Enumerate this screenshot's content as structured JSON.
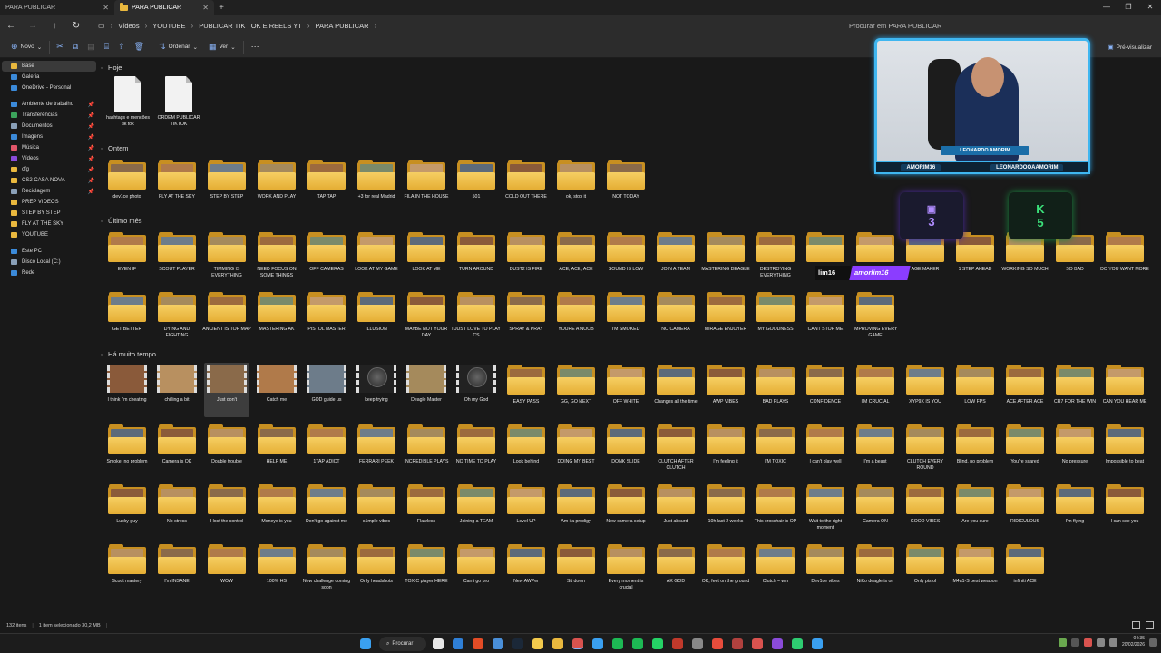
{
  "tabs": [
    {
      "label": "PARA PUBLICAR",
      "active": false
    },
    {
      "label": "PARA PUBLICAR",
      "active": true
    }
  ],
  "breadcrumbs": [
    "Vídeos",
    "YOUTUBE",
    "PUBLICAR TIK TOK E REELS YT",
    "PARA PUBLICAR"
  ],
  "search_placeholder": "Procurar em PARA PUBLICAR",
  "toolbar": {
    "new_label": "Novo",
    "sort_label": "Ordenar",
    "view_label": "Ver",
    "preview_label": "Pré-visualizar"
  },
  "sidebar": {
    "quick": [
      {
        "label": "Base",
        "color": "#e9b83e",
        "sel": true
      },
      {
        "label": "Galeria",
        "color": "#3b8ad9"
      },
      {
        "label": "OneDrive - Personal",
        "color": "#3b8ad9"
      }
    ],
    "pinned": [
      {
        "label": "Ambiente de trabalho",
        "color": "#3b8ad9",
        "pin": true
      },
      {
        "label": "Transferências",
        "color": "#3ca45c",
        "pin": true
      },
      {
        "label": "Documentos",
        "color": "#8aa0b8",
        "pin": true
      },
      {
        "label": "Imagens",
        "color": "#3b8ad9",
        "pin": true
      },
      {
        "label": "Música",
        "color": "#e2566a",
        "pin": true
      },
      {
        "label": "Vídeos",
        "color": "#8a4bd9",
        "pin": true
      },
      {
        "label": "cfg",
        "color": "#e9b83e",
        "pin": true
      },
      {
        "label": "CS2 CASA NOVA",
        "color": "#e9b83e",
        "pin": true
      },
      {
        "label": "Reciclagem",
        "color": "#8aa0b8",
        "pin": true
      },
      {
        "label": "PREP VIDEOS",
        "color": "#e9b83e"
      },
      {
        "label": "STEP BY STEP",
        "color": "#e9b83e"
      },
      {
        "label": "FLY AT THE SKY",
        "color": "#e9b83e"
      },
      {
        "label": "YOUTUBE",
        "color": "#e9b83e"
      }
    ],
    "devices": [
      {
        "label": "Este PC",
        "color": "#3b8ad9"
      },
      {
        "label": "Disco Local (C:)",
        "color": "#8aa0b8"
      },
      {
        "label": "Rede",
        "color": "#3b8ad9"
      }
    ]
  },
  "groups": [
    {
      "title": "Hoje",
      "items": [
        {
          "label": "hashtags e menções tik tok",
          "kind": "doc"
        },
        {
          "label": "ORDEM PUBLICAR TIKTOK",
          "kind": "doc"
        }
      ]
    },
    {
      "title": "Ontem",
      "items": [
        {
          "label": "dev1ce photo"
        },
        {
          "label": "FLY AT THE SKY"
        },
        {
          "label": "STEP BY STEP"
        },
        {
          "label": "WORK AND PLAY"
        },
        {
          "label": "TAP TAP"
        },
        {
          "label": "+3 for real Madrid"
        },
        {
          "label": "FILA IN THE HOUSE"
        },
        {
          "label": "501"
        },
        {
          "label": "COLD OUT THERE"
        },
        {
          "label": "ok, stop it"
        },
        {
          "label": "NOT TODAY"
        }
      ]
    },
    {
      "title": "Último mês",
      "items": [
        {
          "label": "EVEN IF"
        },
        {
          "label": "SCOUT PLAYER"
        },
        {
          "label": "TIMMING IS EVERYTHING"
        },
        {
          "label": "NEED FOCUS ON SOME THINGS"
        },
        {
          "label": "OFF CAMERAS"
        },
        {
          "label": "LOOK AT MY GAME"
        },
        {
          "label": "LOOK AT ME"
        },
        {
          "label": "TURN AROUND"
        },
        {
          "label": "DUST2 IS FIRE"
        },
        {
          "label": "ACE, ACE, ACE"
        },
        {
          "label": "SOUND IS LOW"
        },
        {
          "label": "JOIN A TEAM"
        },
        {
          "label": "MASTERING DEAGLE"
        },
        {
          "label": "DESTROYING EVERYTHING"
        },
        {
          "label": "R"
        },
        {
          "label": ""
        },
        {
          "label": "AGE MAKER"
        },
        {
          "label": "1 STEP AHEAD"
        },
        {
          "label": "WORKING SO MUCH"
        },
        {
          "label": "SO BAD"
        },
        {
          "label": "DO YOU WANT MORE"
        },
        {
          "label": "GET BETTER"
        },
        {
          "label": "DYING AND FIGHTING"
        },
        {
          "label": "ANCIENT IS TOP MAP"
        },
        {
          "label": "MASTERING AK"
        },
        {
          "label": "PISTOL MASTER"
        },
        {
          "label": "ILLUSION"
        },
        {
          "label": "MAYBE NOT YOUR DAY"
        },
        {
          "label": "I JUST LOVE TO PLAY CS"
        },
        {
          "label": "SPRAY & PRAY"
        },
        {
          "label": "YOURE A NOOB"
        },
        {
          "label": "I'M SMOKED"
        },
        {
          "label": "NO CAMERA"
        },
        {
          "label": "MIRAGE ENJOYER"
        },
        {
          "label": "MY GOODNESS"
        },
        {
          "label": "CANT STOP ME"
        },
        {
          "label": "IMPROVING EVERY GAME"
        }
      ]
    },
    {
      "title": "Há muito tempo",
      "items": [
        {
          "label": "I think I'm cheating",
          "kind": "video"
        },
        {
          "label": "chilling a bit",
          "kind": "video"
        },
        {
          "label": "Just don't",
          "kind": "video",
          "sel": true
        },
        {
          "label": "Catch me",
          "kind": "video"
        },
        {
          "label": "GOD guide us",
          "kind": "video"
        },
        {
          "label": "keep trying",
          "kind": "scope"
        },
        {
          "label": "Deagle Master",
          "kind": "video"
        },
        {
          "label": "Oh my God",
          "kind": "scope"
        },
        {
          "label": "EASY PASS"
        },
        {
          "label": "GG, GO NEXT"
        },
        {
          "label": "OFF WHITE"
        },
        {
          "label": "Changes all the time"
        },
        {
          "label": "AWP VIBES"
        },
        {
          "label": "BAD PLAYS"
        },
        {
          "label": "CONFIDENCE"
        },
        {
          "label": "I'M CRUCIAL"
        },
        {
          "label": "XYP9X IS YOU"
        },
        {
          "label": "LOW FPS"
        },
        {
          "label": "ACE AFTER ACE"
        },
        {
          "label": "CR7 FOR THE WIN"
        },
        {
          "label": "CAN YOU HEAR ME"
        },
        {
          "label": "Smoke, no problem"
        },
        {
          "label": "Camera is OK"
        },
        {
          "label": "Double trouble"
        },
        {
          "label": "HELP ME"
        },
        {
          "label": "1TAP ADICT"
        },
        {
          "label": "FERRARI PEEK"
        },
        {
          "label": "INCREDIBLE PLAYS"
        },
        {
          "label": "NO TIME TO PLAY"
        },
        {
          "label": "Look behind"
        },
        {
          "label": "DOING MY BEST"
        },
        {
          "label": "DONK SLIDE"
        },
        {
          "label": "CLUTCH AFTER CLUTCH"
        },
        {
          "label": "I'm feeling it"
        },
        {
          "label": "I'M TOXIC"
        },
        {
          "label": "I can't play well"
        },
        {
          "label": "I'm a beast"
        },
        {
          "label": "CLUTCH EVERY ROUND"
        },
        {
          "label": "Blind, no problem"
        },
        {
          "label": "You're scared"
        },
        {
          "label": "No pressure"
        },
        {
          "label": "Impossible to beat"
        },
        {
          "label": "Lucky guy"
        },
        {
          "label": "No stress"
        },
        {
          "label": "I lost the control"
        },
        {
          "label": "Moneys is you"
        },
        {
          "label": "Don't go against me"
        },
        {
          "label": "s1mple vibes"
        },
        {
          "label": "Flawless"
        },
        {
          "label": "Joining a TEAM"
        },
        {
          "label": "Level UP"
        },
        {
          "label": "Am i a prodigy"
        },
        {
          "label": "New camera setup"
        },
        {
          "label": "Just absurd"
        },
        {
          "label": "10h last 2 weeks"
        },
        {
          "label": "This crosshair is OP"
        },
        {
          "label": "Wait to the right moment"
        },
        {
          "label": "Camera ON"
        },
        {
          "label": "GOOD VIBES"
        },
        {
          "label": "Are you sure"
        },
        {
          "label": "RIDICULOUS"
        },
        {
          "label": "I'm flying"
        },
        {
          "label": "I can see you"
        },
        {
          "label": "Scout mastery"
        },
        {
          "label": "I'm INSANE"
        },
        {
          "label": "WOW"
        },
        {
          "label": "100% HS"
        },
        {
          "label": "New challenge coming soon"
        },
        {
          "label": "Only headshots"
        },
        {
          "label": "TOXIC player HERE"
        },
        {
          "label": "Can i go pro"
        },
        {
          "label": "New AWPer"
        },
        {
          "label": "Sit down"
        },
        {
          "label": "Every moment is crucial"
        },
        {
          "label": "AK GOD"
        },
        {
          "label": "OK, feet on the ground"
        },
        {
          "label": "Clutch = win"
        },
        {
          "label": "Dev1ce vibes"
        },
        {
          "label": "NiKo deagle is on"
        },
        {
          "label": "Only pistol"
        },
        {
          "label": "M4a1-S best weapon"
        },
        {
          "label": "infiniti ACE"
        }
      ]
    }
  ],
  "status": {
    "count": "132 itens",
    "selected": "1 item selecionado 30,2 MB"
  },
  "taskbar": {
    "search_label": "Procurar",
    "time": "04:35",
    "date": "20/02/2026"
  },
  "overlay": {
    "cam_name": "LEONARDO AMORIM",
    "handle_left": "AMORIM16",
    "handle_right": "LEONARDOOAAMORIM",
    "badge1_glyph": "3",
    "badge2_glyph": "K",
    "badge2_num": "5",
    "stream_a": "lim16",
    "stream_b": "amorlim16"
  }
}
